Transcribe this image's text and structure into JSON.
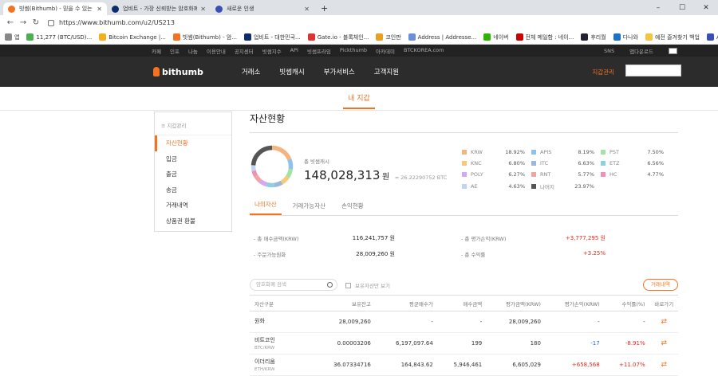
{
  "browser": {
    "tabs": [
      {
        "label": "빗썸(Bithumb) - 믿을 수 있는 암",
        "color": "#f37321",
        "active": true
      },
      {
        "label": "업비트 - 가장 신뢰받는 암호화폐",
        "color": "#0c2c6b",
        "active": false
      },
      {
        "label": "새로운 인생",
        "color": "#3a4fb3",
        "active": false
      }
    ],
    "new_tab": "+",
    "url": "https://www.bithumb.com/u2/US213",
    "bookmarks": [
      {
        "label": "앱",
        "color": "#888"
      },
      {
        "label": "11,277 (BTC/USD)...",
        "color": "#4caf50"
      },
      {
        "label": "Bitcoin Exchange |...",
        "color": "#f2b01e"
      },
      {
        "label": "빗썸(Bithumb) - 암...",
        "color": "#f37321"
      },
      {
        "label": "업비트 - 대한민국...",
        "color": "#0c2c6b"
      },
      {
        "label": "Gate.io - 블록체인...",
        "color": "#d33"
      },
      {
        "label": "코인판",
        "color": "#e9a020"
      },
      {
        "label": "Address | Addresse...",
        "color": "#6b8ed6"
      },
      {
        "label": "네이버",
        "color": "#2db400"
      },
      {
        "label": "전체 메일함 : 네이...",
        "color": "#c00"
      },
      {
        "label": "후리월",
        "color": "#223"
      },
      {
        "label": "다나와",
        "color": "#1a73c8"
      },
      {
        "label": "예전 즐겨찾기 백업",
        "color": "#f5c542"
      },
      {
        "label": "Assa",
        "color": "#3a4fb3"
      }
    ]
  },
  "site": {
    "top_links": [
      "카페",
      "인포",
      "나눔",
      "이용안내",
      "공지센터",
      "빗썸지수",
      "API",
      "빗썸프라임",
      "Pickthumb",
      "아카데미",
      "BTCKOREA.com"
    ],
    "top_right": [
      "SNS",
      "앱다운로드"
    ],
    "logo": "bithumb",
    "main_menu": [
      "거래소",
      "빗썸캐시",
      "부가서비스",
      "고객지원"
    ],
    "wallet_menu": "지갑관리",
    "sub_header": "내 지갑"
  },
  "sidebar": {
    "title": "지갑관리",
    "items": [
      "자산현황",
      "입금",
      "출금",
      "송금",
      "거래내역",
      "상품권 환불"
    ]
  },
  "content": {
    "title": "자산현황",
    "total_label": "총 빗썸캐시",
    "total_value": "148,028,313",
    "total_unit": "원",
    "total_btc": "≈ 26.22290752 BTC",
    "tabs": [
      "나의자산",
      "거래가능자산",
      "손익현황"
    ],
    "summary": [
      {
        "label": "- 총 매수금액(KRW)",
        "value": "116,241,757 원",
        "color": "normal"
      },
      {
        "label": "- 총 평가손익(KRW)",
        "value": "+3,777,295 원",
        "color": "red"
      },
      {
        "label": "- 주문가능원화",
        "value": "28,009,260 원",
        "color": "normal"
      },
      {
        "label": "- 총 수익률",
        "value": "+3.25%",
        "color": "red"
      }
    ],
    "search_placeholder": "암호화폐 검색",
    "checkbox_label": "보유자산만 보기",
    "history_button": "거래내역",
    "table": {
      "headers": [
        "자산구분",
        "보유잔고",
        "평균매수가",
        "매수금액",
        "평가금액(KRW)",
        "평가손익(KRW)",
        "수익률(%)",
        "바로가기"
      ],
      "rows": [
        {
          "name": "원화",
          "pair": "",
          "balance": "28,009,260",
          "avg": "-",
          "buy": "-",
          "eval": "28,009,260",
          "pnl": "-",
          "pnl_color": "normal",
          "rate": "-",
          "rate_color": "normal"
        },
        {
          "name": "비트코인",
          "pair": "BTC/KRW",
          "balance": "0.00003206",
          "avg": "6,197,097.64",
          "buy": "199",
          "eval": "180",
          "pnl": "-17",
          "pnl_color": "blue",
          "rate": "-8.91%",
          "rate_color": "red"
        },
        {
          "name": "이더리움",
          "pair": "ETH/KRW",
          "balance": "36.07334716",
          "avg": "164,843.62",
          "buy": "5,946,461",
          "eval": "6,605,029",
          "pnl": "+658,568",
          "pnl_color": "red",
          "rate": "+11.07%",
          "rate_color": "red"
        }
      ]
    }
  },
  "chart_data": {
    "type": "pie",
    "categories": [
      "KRW",
      "APIS",
      "PST",
      "KNC",
      "ITC",
      "ETZ",
      "POLY",
      "RNT",
      "HC",
      "AE",
      "나머지"
    ],
    "values": [
      18.92,
      8.19,
      7.5,
      6.8,
      6.63,
      6.56,
      6.27,
      5.77,
      4.77,
      4.63,
      23.97
    ],
    "labels": [
      "18.92%",
      "8.19%",
      "7.50%",
      "6.80%",
      "6.63%",
      "6.56%",
      "6.27%",
      "5.77%",
      "4.77%",
      "4.63%",
      "23.97%"
    ],
    "colors": [
      "#f5b47f",
      "#8cc1f0",
      "#a5e3a5",
      "#f7c97a",
      "#9eb7d8",
      "#8fd0e0",
      "#d7a8f0",
      "#f2a3a3",
      "#f08fb8",
      "#c2d4f5",
      "#555555"
    ]
  }
}
